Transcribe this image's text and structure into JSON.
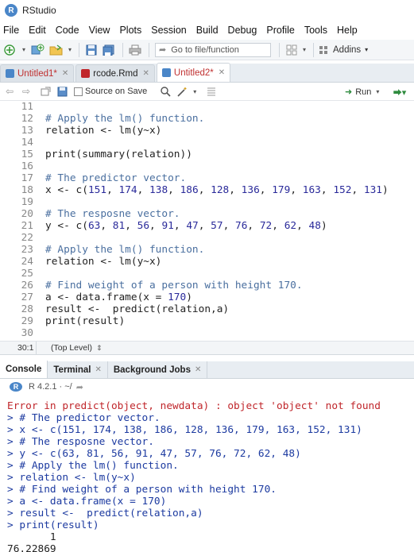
{
  "window": {
    "title": "RStudio",
    "logo": "R"
  },
  "menu": [
    "File",
    "Edit",
    "Code",
    "View",
    "Plots",
    "Session",
    "Build",
    "Debug",
    "Profile",
    "Tools",
    "Help"
  ],
  "toolbar": {
    "goto_placeholder": "Go to file/function",
    "addins_label": "Addins"
  },
  "source_tabs": [
    {
      "label": "Untitled1*",
      "active": false,
      "modified": true
    },
    {
      "label": "rcode.Rmd",
      "active": false,
      "modified": false
    },
    {
      "label": "Untitled2*",
      "active": true,
      "modified": true
    }
  ],
  "editor_toolbar": {
    "source_on_save": "Source on Save",
    "run_label": "Run"
  },
  "editor": {
    "lines": [
      {
        "n": "11",
        "text": ""
      },
      {
        "n": "12",
        "text": "# Apply the lm() function.",
        "kind": "comment"
      },
      {
        "n": "13",
        "text": "relation <- lm(y~x)"
      },
      {
        "n": "14",
        "text": ""
      },
      {
        "n": "15",
        "text": "print(summary(relation))"
      },
      {
        "n": "16",
        "text": ""
      },
      {
        "n": "17",
        "text": "# The predictor vector.",
        "kind": "comment"
      },
      {
        "n": "18",
        "text": "x <- c(151, 174, 138, 186, 128, 136, 179, 163, 152, 131)"
      },
      {
        "n": "19",
        "text": ""
      },
      {
        "n": "20",
        "text": "# The resposne vector.",
        "kind": "comment"
      },
      {
        "n": "21",
        "text": "y <- c(63, 81, 56, 91, 47, 57, 76, 72, 62, 48)"
      },
      {
        "n": "22",
        "text": ""
      },
      {
        "n": "23",
        "text": "# Apply the lm() function.",
        "kind": "comment"
      },
      {
        "n": "24",
        "text": "relation <- lm(y~x)"
      },
      {
        "n": "25",
        "text": ""
      },
      {
        "n": "26",
        "text": "# Find weight of a person with height 170.",
        "kind": "comment"
      },
      {
        "n": "27",
        "text": "a <- data.frame(x = 170)"
      },
      {
        "n": "28",
        "text": "result <-  predict(relation,a)"
      },
      {
        "n": "29",
        "text": "print(result)"
      },
      {
        "n": "30",
        "text": ""
      }
    ]
  },
  "status": {
    "position": "30:1",
    "scope": "(Top Level)"
  },
  "console_tabs": [
    {
      "label": "Console",
      "active": true,
      "closable": false
    },
    {
      "label": "Terminal",
      "active": false,
      "closable": true
    },
    {
      "label": "Background Jobs",
      "active": false,
      "closable": true
    }
  ],
  "console_path": "R 4.2.1 · ~/",
  "console": {
    "lines": [
      {
        "text": "Error in predict(object, newdata) : object 'object' not found",
        "kind": "err"
      },
      {
        "text": "> # The predictor vector.",
        "kind": "cmd"
      },
      {
        "text": "> x <- c(151, 174, 138, 186, 128, 136, 179, 163, 152, 131)",
        "kind": "cmd"
      },
      {
        "text": "> # The resposne vector.",
        "kind": "cmd"
      },
      {
        "text": "> y <- c(63, 81, 56, 91, 47, 57, 76, 72, 62, 48)",
        "kind": "cmd"
      },
      {
        "text": "> # Apply the lm() function.",
        "kind": "cmd"
      },
      {
        "text": "> relation <- lm(y~x)",
        "kind": "cmd"
      },
      {
        "text": "> # Find weight of a person with height 170.",
        "kind": "cmd"
      },
      {
        "text": "> a <- data.frame(x = 170)",
        "kind": "cmd"
      },
      {
        "text": "> result <-  predict(relation,a)",
        "kind": "cmd"
      },
      {
        "text": "> print(result)",
        "kind": "cmd"
      },
      {
        "text": "       1",
        "kind": "out"
      },
      {
        "text": "76.22869",
        "kind": "out"
      }
    ]
  }
}
